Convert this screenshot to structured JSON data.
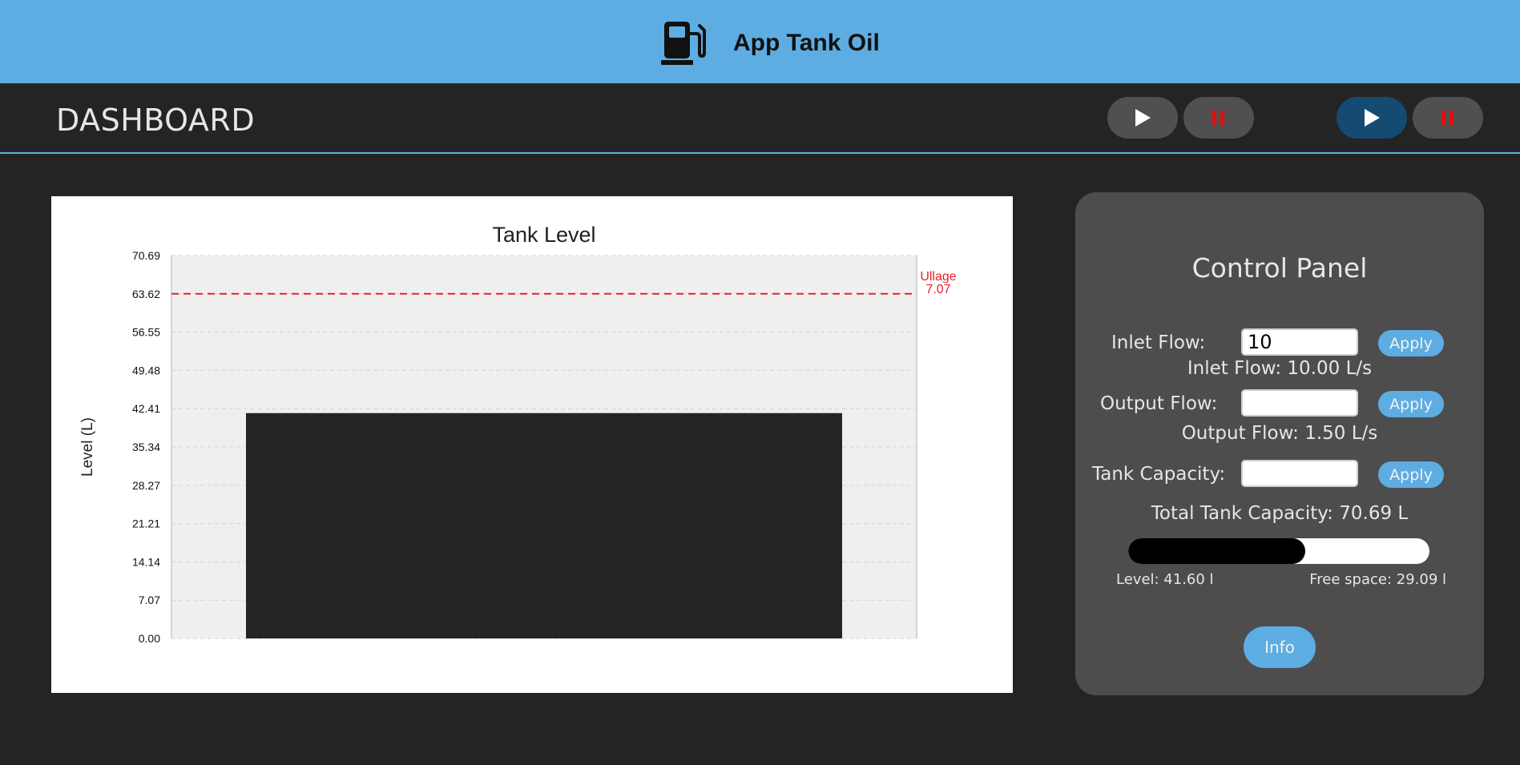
{
  "header": {
    "app_title": "App Tank Oil",
    "icon": "fuel-pump-icon"
  },
  "subheader": {
    "title": "DASHBOARD",
    "buttons": [
      {
        "icon": "play-icon",
        "active": false
      },
      {
        "icon": "pause-icon",
        "active": false
      },
      {
        "icon": "play-icon",
        "active": true
      },
      {
        "icon": "pause-icon",
        "active": false
      }
    ]
  },
  "chart_data": {
    "type": "bar",
    "title": "Tank Level",
    "xlabel": "",
    "ylabel": "Level (L)",
    "ylim": [
      0,
      70.69
    ],
    "yticks": [
      "0.00",
      "7.07",
      "14.14",
      "21.21",
      "28.27",
      "35.34",
      "42.41",
      "49.48",
      "56.55",
      "63.62",
      "70.69"
    ],
    "categories": [
      ""
    ],
    "values": [
      41.6
    ],
    "grid": true,
    "bar_color": "#242424",
    "reference_line": {
      "value": 63.62,
      "label": "Ullage",
      "label_value": "7.07",
      "color": "#e8222a"
    }
  },
  "panel": {
    "title": "Control Panel",
    "inlet": {
      "label": "Inlet Flow:",
      "value": "10",
      "apply": "Apply",
      "status": "Inlet Flow: 10.00 L/s"
    },
    "output": {
      "label": "Output Flow:",
      "value": "",
      "apply": "Apply",
      "status": "Output Flow: 1.50 L/s"
    },
    "capacity": {
      "label": "Tank Capacity:",
      "value": "",
      "apply": "Apply",
      "status": "Total Tank Capacity: 70.69 L"
    },
    "progress_fraction": 0.5885,
    "level_text": "Level: 41.60 l",
    "free_text": "Free space: 29.09 l",
    "info_label": "Info"
  },
  "colors": {
    "accent": "#5dade2",
    "background": "#242424",
    "panel": "#4d4d4d",
    "pause_red": "#e01010",
    "active_button": "#154a72"
  }
}
